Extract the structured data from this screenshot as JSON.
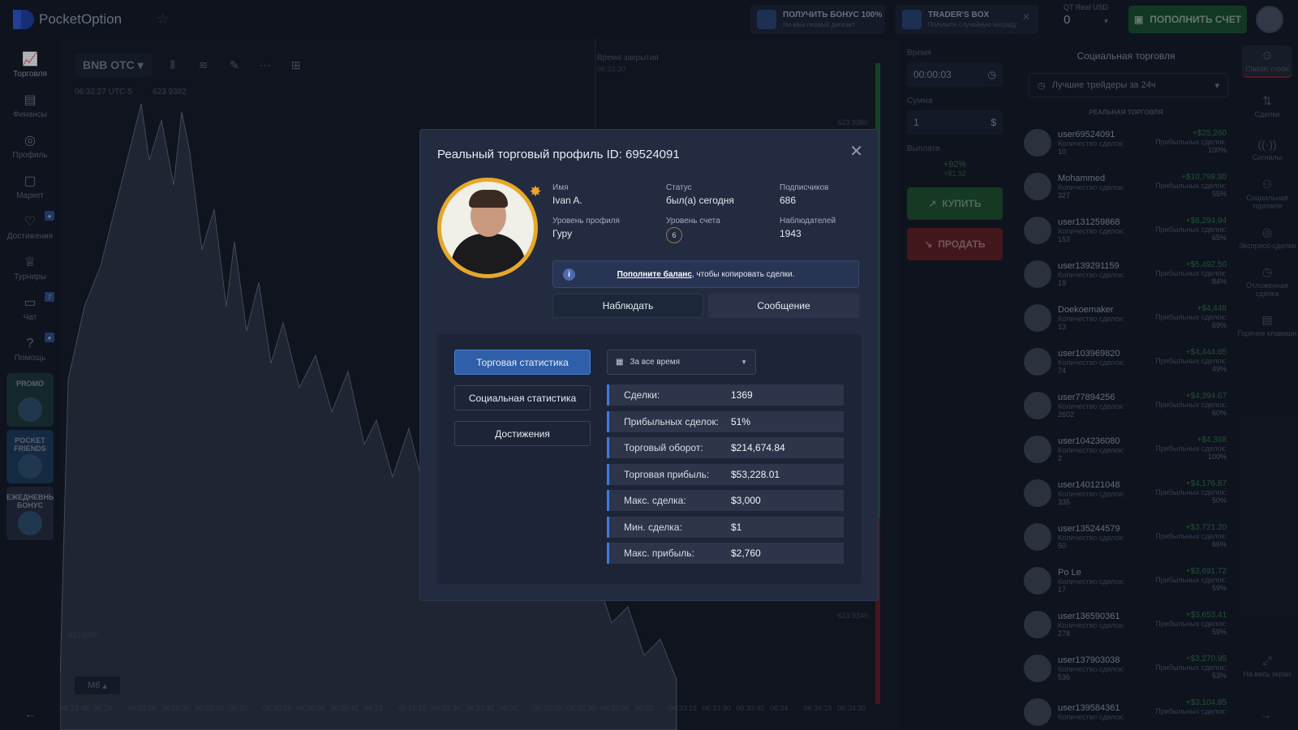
{
  "app": {
    "logo_text": "PocketOption"
  },
  "topbar": {
    "bonus_title": "ПОЛУЧИТЬ БОНУС 100%",
    "bonus_sub": "На ваш первый депозит",
    "box_title": "TRADER'S BOX",
    "box_sub": "Получите случайную награду",
    "account_label": "QT Real",
    "currency": "USD",
    "balance": "0",
    "topup_label": "ПОПОЛНИТЬ СЧЕТ"
  },
  "left_nav": [
    {
      "label": "Торговля",
      "icon": "chart-line-icon"
    },
    {
      "label": "Финансы",
      "icon": "wallet-icon"
    },
    {
      "label": "Профиль",
      "icon": "user-icon"
    },
    {
      "label": "Маркет",
      "icon": "shop-icon"
    },
    {
      "label": "Достижения",
      "icon": "trophy-achievement-icon"
    },
    {
      "label": "Турниры",
      "icon": "cup-icon"
    },
    {
      "label": "Чат",
      "icon": "chat-icon",
      "badge": "7"
    },
    {
      "label": "Помощь",
      "icon": "help-icon"
    }
  ],
  "tiles": {
    "promo": "PROMO",
    "friends": "POCKET FRIENDS",
    "daily": "ЕЖЕДНЕВНЫЙ БОНУС"
  },
  "chart": {
    "pair": "BNB OTC",
    "time": "06:32:27 UTC-5",
    "price": "623.9382",
    "close_label": "Время закрытия",
    "close_time": "06:32:30",
    "timeframe": "M6",
    "y_top": "623.9380",
    "y_bottom": "623.9340",
    "y_left": "623.9340",
    "x_labels": [
      "06:28:45",
      "06:29",
      "06:29:15",
      "06:29:30",
      "06:29:45",
      "06:30",
      "06:30:15",
      "06:30:30",
      "06:30:45",
      "06:31",
      "06:31:15",
      "06:31:30",
      "06:31:45",
      "06:32",
      "06:32:15",
      "06:32:30",
      "06:32:45",
      "06:33",
      "06:33:15",
      "06:33:30",
      "06:33:45",
      "06:34",
      "06:34:15",
      "06:34:30"
    ]
  },
  "trade": {
    "time_label": "Время",
    "time_value": "00:00:03",
    "amount_label": "Сумма",
    "amount_value": "1",
    "payout_label": "Выплата",
    "payout_pct": "+92%",
    "payout_value": "+$1.92",
    "buy_label": "КУПИТЬ",
    "sell_label": "ПРОДАТЬ"
  },
  "social": {
    "header": "Социальная торговля",
    "filter": "Лучшие трейдеры за 24ч",
    "subheader": "РЕАЛЬНАЯ ТОРГОВЛЯ",
    "count_label": "Количество сделок:",
    "win_label": "Прибыльных сделок:",
    "traders": [
      {
        "name": "user69524091",
        "count": "10",
        "profit": "+$25,260",
        "win": "100%"
      },
      {
        "name": "Mohammed",
        "count": "327",
        "profit": "+$10,798.80",
        "win": "55%"
      },
      {
        "name": "user131259868",
        "count": "153",
        "profit": "+$6,294.94",
        "win": "65%"
      },
      {
        "name": "user139291159",
        "count": "19",
        "profit": "+$5,492.50",
        "win": "84%"
      },
      {
        "name": "Doekoemaker",
        "count": "13",
        "profit": "+$4,448",
        "win": "69%"
      },
      {
        "name": "user103969820",
        "count": "74",
        "profit": "+$4,444.65",
        "win": "49%"
      },
      {
        "name": "user77894256",
        "count": "2602",
        "profit": "+$4,394.67",
        "win": "60%"
      },
      {
        "name": "user104236080",
        "count": "2",
        "profit": "+$4,368",
        "win": "100%"
      },
      {
        "name": "user140121048",
        "count": "335",
        "profit": "+$4,176.87",
        "win": "50%"
      },
      {
        "name": "user135244579",
        "count": "50",
        "profit": "+$3,721.20",
        "win": "66%"
      },
      {
        "name": "Po Le",
        "count": "17",
        "profit": "+$3,691.72",
        "win": "59%"
      },
      {
        "name": "user136590361",
        "count": "278",
        "profit": "+$3,653.41",
        "win": "59%"
      },
      {
        "name": "user137903038",
        "count": "536",
        "profit": "+$3,270.95",
        "win": "53%"
      },
      {
        "name": "user139584361",
        "count": "",
        "profit": "+$3,104.85",
        "win": ""
      }
    ]
  },
  "right_nav": [
    {
      "label": "Classic mode",
      "icon": "classic-mode-icon"
    },
    {
      "label": "Сделки",
      "icon": "trades-icon"
    },
    {
      "label": "Сигналы",
      "icon": "signals-icon"
    },
    {
      "label": "Социальная торговля",
      "icon": "social-icon"
    },
    {
      "label": "Экспресс-сделки",
      "icon": "express-icon"
    },
    {
      "label": "Отложенная сделка",
      "icon": "pending-icon"
    },
    {
      "label": "Горячие клавиши",
      "icon": "keyboard-icon"
    },
    {
      "label": "На весь экран",
      "icon": "fullscreen-icon"
    }
  ],
  "modal": {
    "title": "Реальный торговый профиль ID: 69524091",
    "name_label": "Имя",
    "name_value": "Ivan A.",
    "status_label": "Статус",
    "status_value": "был(а) сегодня",
    "subs_label": "Подписчиков",
    "subs_value": "686",
    "level_label": "Уровень профиля",
    "level_value": "Гуру",
    "account_level_label": "Уровень счета",
    "account_level_value": "6",
    "watchers_label": "Наблюдателей",
    "watchers_value": "1943",
    "notice_link": "Пополните баланс",
    "notice_rest": ", чтобы копировать сделки.",
    "watch_button": "Наблюдать",
    "message_button": "Сообщение",
    "tabs": [
      "Торговая статистика",
      "Социальная статистика",
      "Достижения"
    ],
    "period": "За все время",
    "stats": [
      {
        "label": "Сделки:",
        "value": "1369"
      },
      {
        "label": "Прибыльных сделок:",
        "value": "51%"
      },
      {
        "label": "Торговый оборот:",
        "value": "$214,674.84"
      },
      {
        "label": "Торговая прибыль:",
        "value": "$53,228.01"
      },
      {
        "label": "Макс. сделка:",
        "value": "$3,000"
      },
      {
        "label": "Мин. сделка:",
        "value": "$1"
      },
      {
        "label": "Макс. прибыль:",
        "value": "$2,760"
      }
    ]
  }
}
